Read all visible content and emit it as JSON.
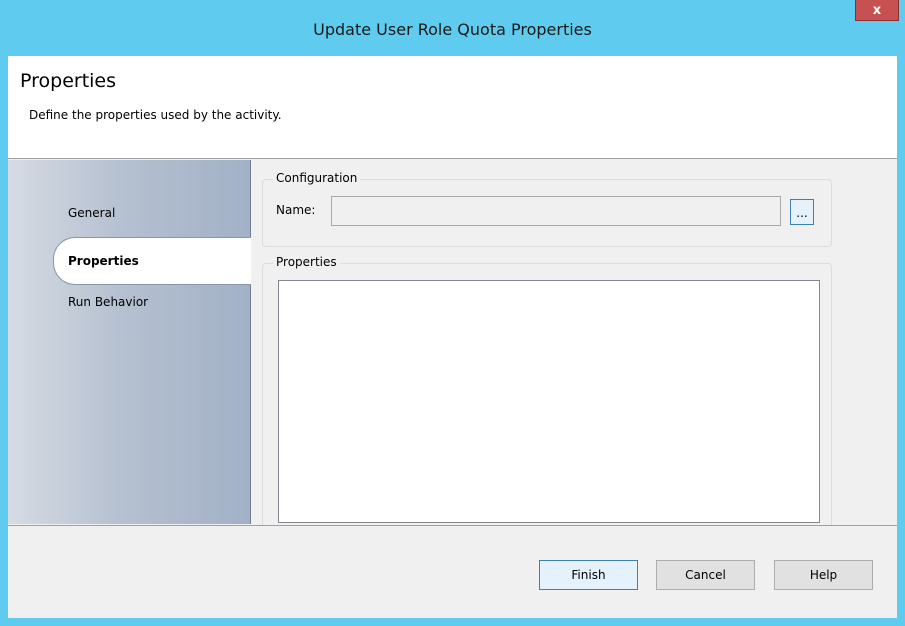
{
  "window": {
    "title": "Update User Role Quota Properties",
    "close_glyph": "x"
  },
  "header": {
    "title": "Properties",
    "subtitle": "Define the properties used by the activity."
  },
  "sidebar": {
    "items": [
      {
        "label": "General",
        "selected": false
      },
      {
        "label": "Properties",
        "selected": true
      },
      {
        "label": "Run Behavior",
        "selected": false
      }
    ]
  },
  "configuration": {
    "group_label": "Configuration",
    "name_label": "Name:",
    "name_value": "",
    "browse_label": "..."
  },
  "properties": {
    "group_label": "Properties"
  },
  "footer": {
    "finish_label": "Finish",
    "cancel_label": "Cancel",
    "help_label": "Help"
  },
  "colors": {
    "titlebar": "#5ecbef",
    "close_button": "#c75050",
    "sidebar_gradient_end": "#a2b1c6"
  }
}
